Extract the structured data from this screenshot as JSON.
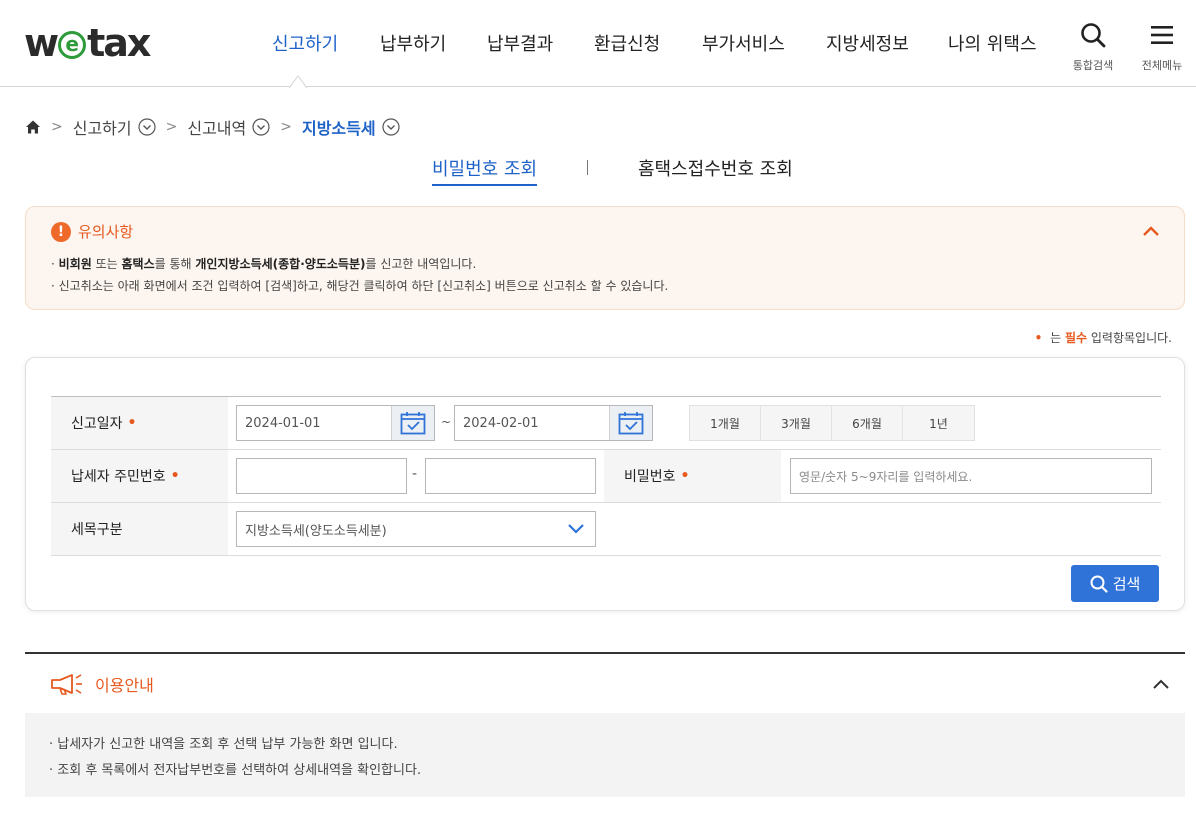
{
  "header": {
    "logo_we": "w",
    "logo_e": "e",
    "logo_tax": "tax",
    "nav": [
      "신고하기",
      "납부하기",
      "납부결과",
      "환급신청",
      "부가서비스",
      "지방세정보",
      "나의 위택스"
    ],
    "util_search": "통합검색",
    "util_menu": "전체메뉴"
  },
  "breadcrumb": [
    "신고하기",
    "신고내역",
    "지방소득세"
  ],
  "tabs": [
    "비밀번호 조회",
    "홈택스접수번호 조회"
  ],
  "notice": {
    "title": "유의사항",
    "line1": {
      "bullet": "·",
      "a": "비회원",
      "b": " 또는 ",
      "c": "홈택스",
      "d": "를 통해 ",
      "e": "개인지방소득세(종합·양도소득분)",
      "f": "를 신고한 내역입니다."
    },
    "line2": "· 신고취소는 아래 화면에서 조건 입력하여 [검색]하고, 해당건 클릭하여 하단 [신고취소] 버튼으로 신고취소 할 수 있습니다."
  },
  "required_note": {
    "dot": "•",
    "pre": " 는 ",
    "req": "필수",
    "post": " 입력항목입니다."
  },
  "form": {
    "report_date_label": "신고일자",
    "date_from": "2024-01-01",
    "date_tilde": "~",
    "date_to": "2024-02-01",
    "periods": [
      "1개월",
      "3개월",
      "6개월",
      "1년"
    ],
    "resident_no_label": "납세자 주민번호",
    "resident_dash": "-",
    "password_label": "비밀번호",
    "password_placeholder": "영문/숫자 5~9자리를 입력하세요.",
    "tax_type_label": "세목구분",
    "tax_type_value": "지방소득세(양도소득세분)",
    "required_mark": "•",
    "search_button": "검색"
  },
  "guide": {
    "title": "이용안내",
    "lines": [
      "· 납세자가 신고한 내역을 조회 후 선택 납부 가능한 화면 입니다.",
      "· 조회 후 목록에서 전자납부번호를 선택하여 상세내역을 확인합니다."
    ]
  },
  "colors": {
    "primary": "#1f63c8",
    "accent": "#e6591f",
    "button": "#2f73d9",
    "logo_green": "#2e9b3b"
  }
}
